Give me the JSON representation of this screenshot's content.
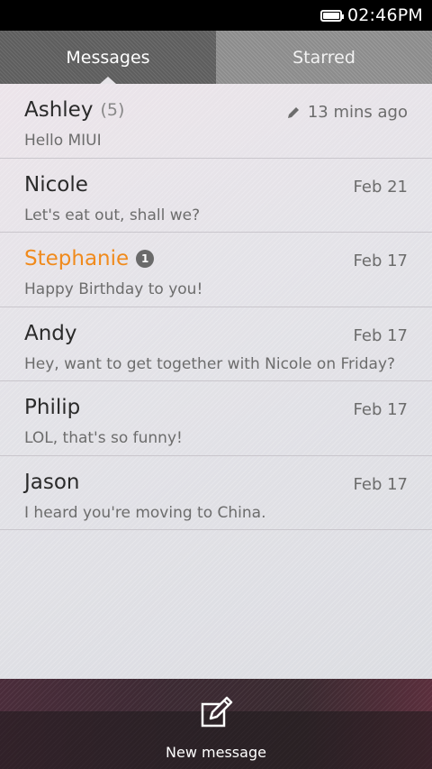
{
  "status": {
    "time": "02:46PM"
  },
  "tabs": [
    {
      "label": "Messages",
      "active": true
    },
    {
      "label": "Starred",
      "active": false
    }
  ],
  "threads": [
    {
      "name": "Ashley",
      "count": "(5)",
      "date": "13 mins ago",
      "preview": "Hello MIUI",
      "draft": true
    },
    {
      "name": "Nicole",
      "count": "",
      "date": "Feb 21",
      "preview": "Let's eat out, shall we?"
    },
    {
      "name": "Stephanie",
      "badge": "1",
      "date": "Feb 17",
      "preview": "Happy Birthday to you!",
      "unread": true
    },
    {
      "name": "Andy",
      "count": "",
      "date": "Feb 17",
      "preview": "Hey, want to get together with Nicole on Friday?"
    },
    {
      "name": "Philip",
      "count": "",
      "date": "Feb 17",
      "preview": "LOL, that's so funny!"
    },
    {
      "name": "Jason",
      "count": "",
      "date": "Feb 17",
      "preview": "I heard you're moving to China."
    }
  ],
  "bottom": {
    "new_message_label": "New message"
  },
  "colors": {
    "unread_name": "#f08a1c",
    "badge": "#6a6a6a"
  },
  "icons": {
    "battery": "battery-icon",
    "draft": "pencil-icon",
    "compose": "compose-icon"
  }
}
